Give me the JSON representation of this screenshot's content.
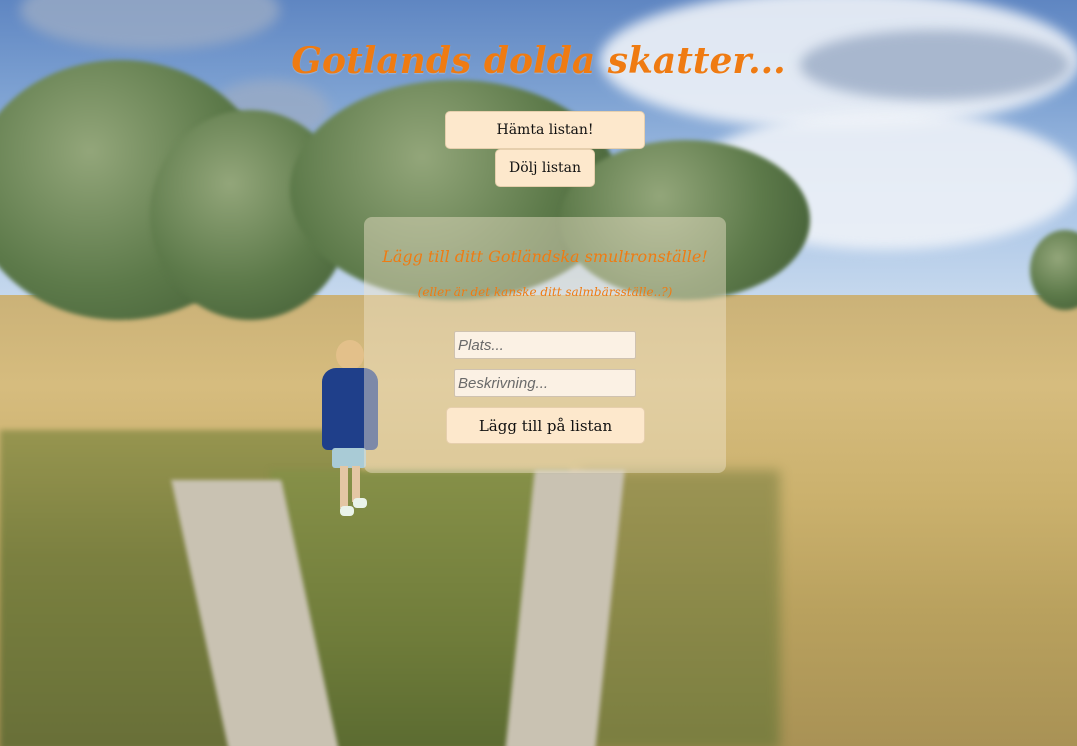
{
  "page": {
    "title": "Gotlands dolda skatter...",
    "accent_color": "#ef7b12",
    "button_color": "#fde8cc"
  },
  "toolbar": {
    "fetch_label": "Hämta listan!",
    "hide_label": "Dölj listan"
  },
  "form": {
    "heading": "Lägg till ditt Gotländska smultronställe!",
    "subheading": "(eller är det kanske ditt salmbärsställe..?)",
    "place_placeholder": "Plats...",
    "description_placeholder": "Beskrivning...",
    "submit_label": "Lägg till på listan"
  }
}
